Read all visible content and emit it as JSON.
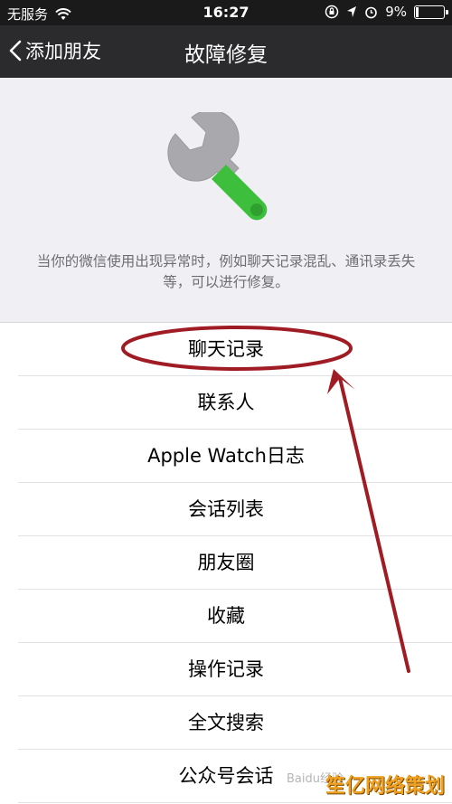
{
  "status_bar": {
    "carrier": "无服务",
    "time": "16:27",
    "battery": "9%"
  },
  "nav": {
    "back_label": "添加朋友",
    "title": "故障修复"
  },
  "hero": {
    "icon": "wrench-icon",
    "description": "当你的微信使用出现异常时，例如聊天记录混乱、通讯录丢失等，可以进行修复。"
  },
  "list": {
    "items": [
      "聊天记录",
      "联系人",
      "Apple Watch日志",
      "会话列表",
      "朋友圈",
      "收藏",
      "操作记录",
      "全文搜索",
      "公众号会话"
    ]
  },
  "watermark": {
    "brand": "笙亿网络策划",
    "baidu": "Baidu经验"
  },
  "colors": {
    "nav_bg": "#2b2b2d",
    "page_bg": "#efeff4",
    "annotation_red": "#a01c24",
    "wrench_green": "#3dbf3d"
  }
}
